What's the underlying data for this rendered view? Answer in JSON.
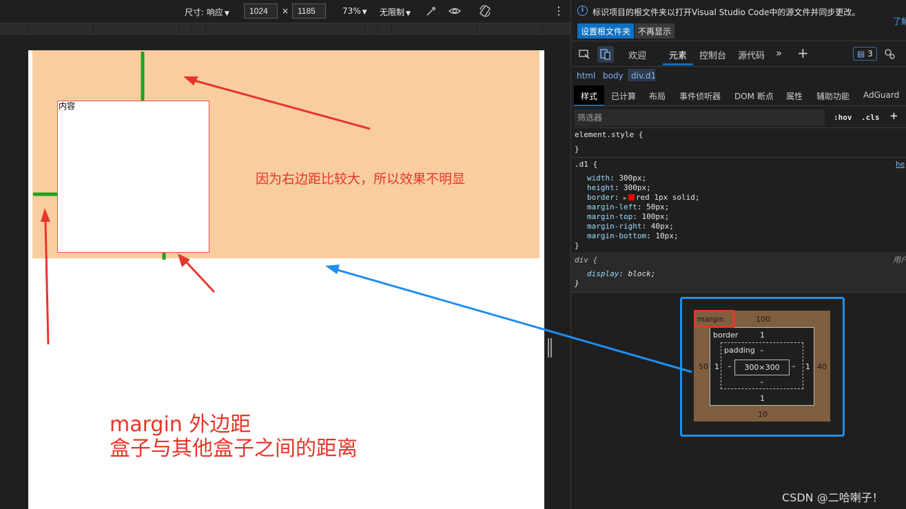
{
  "toolbar": {
    "size_label": "尺寸: 响应",
    "width_value": "1024",
    "times": "×",
    "height_value": "1185",
    "zoom": "73%",
    "throttle": "无限制"
  },
  "page": {
    "box_text": "内容",
    "note_right": "因为右边距比较大，所以效果不明显",
    "note_main_line1": "margin 外边距",
    "note_main_line2": "盒子与其他盒子之间的距离"
  },
  "devtools": {
    "info_text": "标识项目的根文件夹以打开Visual Studio Code中的源文件并同步更改。",
    "info_link": "了解",
    "btn_set_root": "设置根文件夹",
    "btn_dismiss": "不再显示",
    "tabs": [
      "欢迎",
      "元素",
      "控制台",
      "源代码"
    ],
    "issues_count": "3",
    "breadcrumb": [
      "html",
      "body",
      "div.d1"
    ],
    "subtabs": [
      "样式",
      "已计算",
      "布局",
      "事件侦听器",
      "DOM 断点",
      "属性",
      "辅助功能",
      "AdGuard"
    ],
    "filter_placeholder": "筛选器",
    "hov": ":hov",
    "cls": ".cls",
    "element_style_open": "element.style {",
    "close_brace": "}",
    "d1_selector": ".d1 {",
    "d1_source": "he",
    "d1_props": [
      {
        "name": "width",
        "value": "300px;"
      },
      {
        "name": "height",
        "value": "300px;"
      },
      {
        "name": "border",
        "value": "red 1px solid;"
      },
      {
        "name": "margin-left",
        "value": "50px;"
      },
      {
        "name": "margin-top",
        "value": "100px;"
      },
      {
        "name": "margin-right",
        "value": "40px;"
      },
      {
        "name": "margin-bottom",
        "value": "10px;"
      }
    ],
    "div_selector": "div {",
    "div_source": "用户",
    "div_prop": {
      "name": "display",
      "value": "block;"
    }
  },
  "box_model": {
    "margin_label": "margin",
    "margin_top": "100",
    "margin_left": "50",
    "margin_right": "40",
    "margin_bottom": "10",
    "border_label": "border",
    "border_top": "1",
    "border_left": "1",
    "border_right": "1",
    "border_bottom": "1",
    "padding_label": "padding",
    "padding_top": "–",
    "padding_left": "–",
    "padding_right": "–",
    "padding_bottom": "–",
    "content_size": "300×300"
  },
  "watermark": "CSDN @二哈喇子！",
  "colors": {
    "annotation_red": "#e8352a",
    "annotation_green": "#22a020",
    "annotation_blue": "#1e8ff0",
    "body_bg": "#f8cd9f",
    "accent": "#0e70c0"
  }
}
